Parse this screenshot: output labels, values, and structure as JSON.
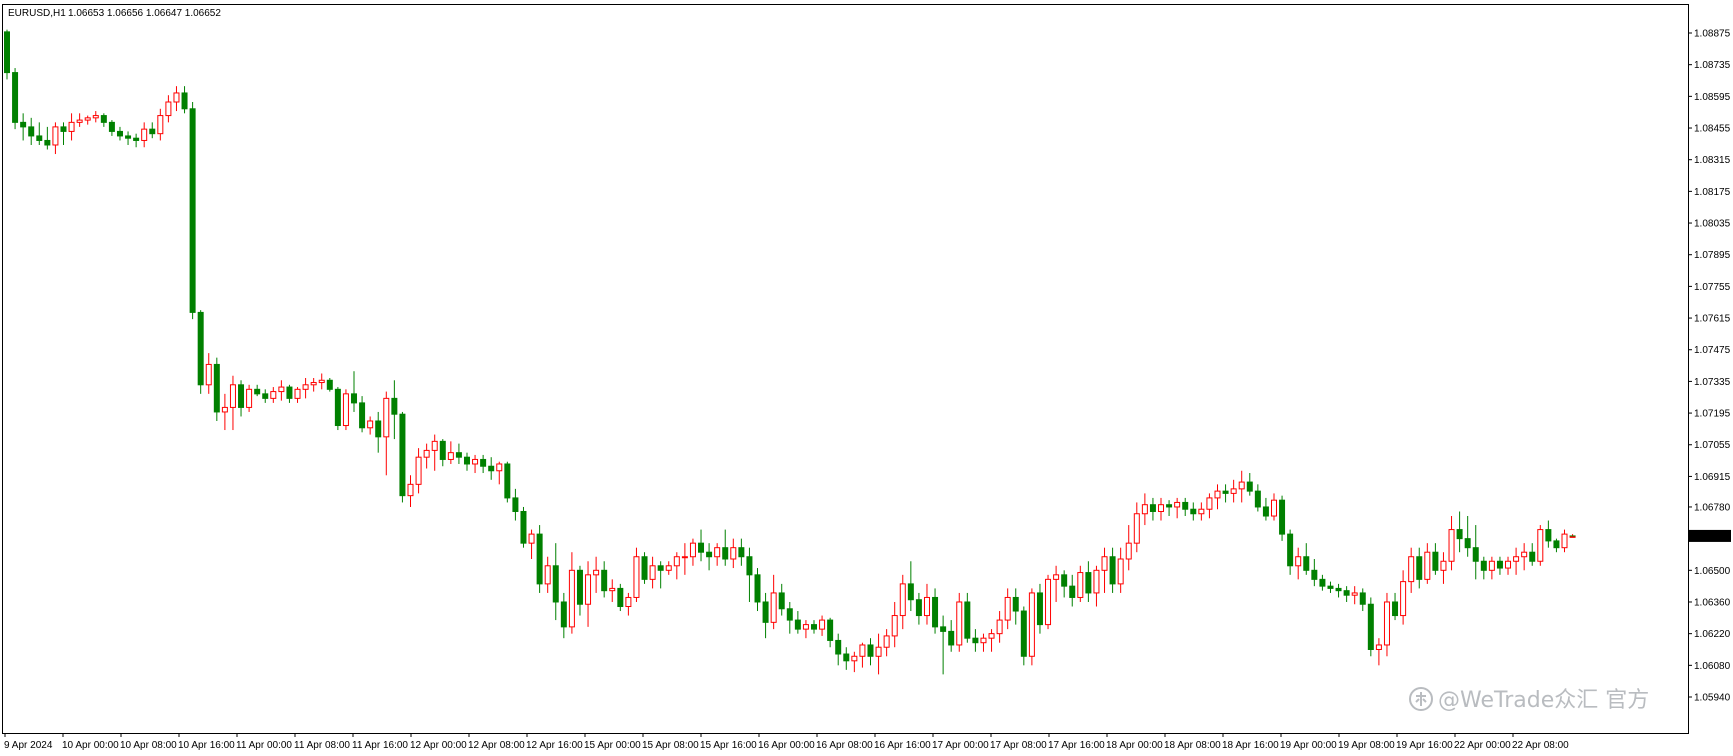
{
  "header": {
    "symbol": "EURUSD,H1",
    "ohlc": "1.06653 1.06656 1.06647 1.06652"
  },
  "watermark": {
    "text": "@WeTrade众汇 官方",
    "icon": "wechat-zhihu-logo-icon"
  },
  "colors": {
    "background": "#ffffff",
    "bull": "#ff0000",
    "bear": "#008000",
    "axis": "#000000",
    "current_price_bg": "#000000",
    "current_price_text": "#ffffff"
  },
  "chart_data": {
    "type": "candlestick",
    "symbol": "EURUSD",
    "timeframe": "H1",
    "grid": false,
    "ylim": [
      1.0594,
      1.0895
    ],
    "price_ticks": [
      "1.08875",
      "1.08735",
      "1.08595",
      "1.08455",
      "1.08315",
      "1.08175",
      "1.08035",
      "1.07895",
      "1.07755",
      "1.07615",
      "1.07475",
      "1.07335",
      "1.07195",
      "1.07055",
      "1.06915",
      "1.06780",
      "1.06652",
      "1.06500",
      "1.06360",
      "1.06220",
      "1.06080",
      "1.05940"
    ],
    "current_price": "1.06652",
    "time_labels": [
      "9 Apr 2024",
      "10 Apr 00:00",
      "10 Apr 08:00",
      "10 Apr 16:00",
      "11 Apr 00:00",
      "11 Apr 08:00",
      "11 Apr 16:00",
      "12 Apr 00:00",
      "12 Apr 08:00",
      "12 Apr 16:00",
      "15 Apr 00:00",
      "15 Apr 08:00",
      "15 Apr 16:00",
      "16 Apr 00:00",
      "16 Apr 08:00",
      "16 Apr 16:00",
      "17 Apr 00:00",
      "17 Apr 08:00",
      "17 Apr 16:00",
      "18 Apr 00:00",
      "18 Apr 08:00",
      "18 Apr 16:00",
      "19 Apr 00:00",
      "19 Apr 08:00",
      "19 Apr 16:00",
      "22 Apr 00:00",
      "22 Apr 08:00"
    ],
    "candles": [
      [
        1.0888,
        1.0889,
        1.0867,
        1.087
      ],
      [
        1.087,
        1.0872,
        1.0845,
        1.0848
      ],
      [
        1.0848,
        1.0852,
        1.084,
        1.0846
      ],
      [
        1.0846,
        1.085,
        1.0838,
        1.0842
      ],
      [
        1.0842,
        1.0848,
        1.0838,
        1.084
      ],
      [
        1.084,
        1.0846,
        1.0836,
        1.0838
      ],
      [
        1.0838,
        1.0848,
        1.0834,
        1.0846
      ],
      [
        1.0846,
        1.0848,
        1.0838,
        1.0844
      ],
      [
        1.0844,
        1.0852,
        1.084,
        1.0848
      ],
      [
        1.0848,
        1.0852,
        1.0846,
        1.0849
      ],
      [
        1.0849,
        1.0851,
        1.0847,
        1.085
      ],
      [
        1.085,
        1.0853,
        1.0848,
        1.0851
      ],
      [
        1.0851,
        1.0852,
        1.0846,
        1.0848
      ],
      [
        1.0848,
        1.0849,
        1.0842,
        1.0844
      ],
      [
        1.0844,
        1.0846,
        1.084,
        1.0842
      ],
      [
        1.0842,
        1.0844,
        1.0838,
        1.0841
      ],
      [
        1.0841,
        1.0843,
        1.0837,
        1.084
      ],
      [
        1.084,
        1.0848,
        1.0837,
        1.0845
      ],
      [
        1.0845,
        1.0848,
        1.0841,
        1.0843
      ],
      [
        1.0843,
        1.0854,
        1.084,
        1.0851
      ],
      [
        1.0851,
        1.086,
        1.0848,
        1.0857
      ],
      [
        1.0857,
        1.0864,
        1.0853,
        1.0861
      ],
      [
        1.0861,
        1.0864,
        1.0852,
        1.0854
      ],
      [
        1.0854,
        1.0857,
        1.0761,
        1.0764
      ],
      [
        1.0764,
        1.0765,
        1.0728,
        1.0732
      ],
      [
        1.0732,
        1.0746,
        1.0728,
        1.0741
      ],
      [
        1.0741,
        1.0744,
        1.0716,
        1.072
      ],
      [
        1.072,
        1.0728,
        1.0712,
        1.0722
      ],
      [
        1.0722,
        1.0736,
        1.0712,
        1.0732
      ],
      [
        1.0732,
        1.0734,
        1.0718,
        1.0722
      ],
      [
        1.0722,
        1.0732,
        1.072,
        1.073
      ],
      [
        1.073,
        1.0732,
        1.0727,
        1.0728
      ],
      [
        1.0728,
        1.073,
        1.0724,
        1.0726
      ],
      [
        1.0726,
        1.0731,
        1.0724,
        1.0729
      ],
      [
        1.0729,
        1.0734,
        1.0725,
        1.0731
      ],
      [
        1.0731,
        1.0732,
        1.0724,
        1.0726
      ],
      [
        1.0726,
        1.0731,
        1.0724,
        1.073
      ],
      [
        1.073,
        1.0735,
        1.0726,
        1.0732
      ],
      [
        1.0732,
        1.0735,
        1.0729,
        1.0733
      ],
      [
        1.0733,
        1.0737,
        1.073,
        1.0734
      ],
      [
        1.0734,
        1.0735,
        1.0729,
        1.073
      ],
      [
        1.073,
        1.0731,
        1.0712,
        1.0714
      ],
      [
        1.0714,
        1.073,
        1.0712,
        1.0728
      ],
      [
        1.0728,
        1.0738,
        1.072,
        1.0724
      ],
      [
        1.0724,
        1.0727,
        1.0711,
        1.0713
      ],
      [
        1.0713,
        1.0718,
        1.071,
        1.0716
      ],
      [
        1.0716,
        1.072,
        1.0702,
        1.0709
      ],
      [
        1.0709,
        1.0729,
        1.0692,
        1.0726
      ],
      [
        1.0726,
        1.0734,
        1.0708,
        1.0719
      ],
      [
        1.0719,
        1.072,
        1.068,
        1.0683
      ],
      [
        1.0683,
        1.0692,
        1.0678,
        1.0688
      ],
      [
        1.0688,
        1.0704,
        1.0684,
        1.07
      ],
      [
        1.07,
        1.0706,
        1.0695,
        1.0703
      ],
      [
        1.0703,
        1.071,
        1.0694,
        1.0707
      ],
      [
        1.0707,
        1.0708,
        1.0696,
        1.0699
      ],
      [
        1.0699,
        1.0707,
        1.0697,
        1.0702
      ],
      [
        1.0702,
        1.0706,
        1.0697,
        1.07
      ],
      [
        1.07,
        1.0702,
        1.0694,
        1.0697
      ],
      [
        1.0697,
        1.0701,
        1.0693,
        1.0699
      ],
      [
        1.0699,
        1.0701,
        1.0693,
        1.0696
      ],
      [
        1.0696,
        1.07,
        1.069,
        1.0694
      ],
      [
        1.0694,
        1.0698,
        1.0688,
        1.0697
      ],
      [
        1.0697,
        1.0698,
        1.068,
        1.0682
      ],
      [
        1.0682,
        1.0686,
        1.0672,
        1.0676
      ],
      [
        1.0676,
        1.0678,
        1.066,
        1.0662
      ],
      [
        1.0662,
        1.0668,
        1.0655,
        1.0666
      ],
      [
        1.0666,
        1.067,
        1.064,
        1.0644
      ],
      [
        1.0644,
        1.0656,
        1.064,
        1.0652
      ],
      [
        1.0652,
        1.0662,
        1.0628,
        1.0636
      ],
      [
        1.0636,
        1.064,
        1.062,
        1.0625
      ],
      [
        1.0625,
        1.0658,
        1.0622,
        1.065
      ],
      [
        1.065,
        1.0652,
        1.063,
        1.0635
      ],
      [
        1.0635,
        1.0654,
        1.0625,
        1.0648
      ],
      [
        1.0648,
        1.0656,
        1.064,
        1.065
      ],
      [
        1.065,
        1.0654,
        1.0638,
        1.0641
      ],
      [
        1.0641,
        1.0646,
        1.0636,
        1.0642
      ],
      [
        1.0642,
        1.0644,
        1.0632,
        1.0634
      ],
      [
        1.0634,
        1.064,
        1.063,
        1.0638
      ],
      [
        1.0638,
        1.066,
        1.0636,
        1.0656
      ],
      [
        1.0656,
        1.0658,
        1.0644,
        1.0646
      ],
      [
        1.0646,
        1.0656,
        1.0642,
        1.0652
      ],
      [
        1.0652,
        1.0654,
        1.0642,
        1.065
      ],
      [
        1.065,
        1.0654,
        1.0648,
        1.0652
      ],
      [
        1.0652,
        1.0658,
        1.0646,
        1.0656
      ],
      [
        1.0656,
        1.0662,
        1.0648,
        1.0656
      ],
      [
        1.0656,
        1.0664,
        1.0652,
        1.0662
      ],
      [
        1.0662,
        1.0668,
        1.0654,
        1.0658
      ],
      [
        1.0658,
        1.0662,
        1.065,
        1.0656
      ],
      [
        1.0656,
        1.0662,
        1.0652,
        1.066
      ],
      [
        1.066,
        1.0668,
        1.0652,
        1.0655
      ],
      [
        1.0655,
        1.0664,
        1.0651,
        1.066
      ],
      [
        1.066,
        1.0664,
        1.0652,
        1.0656
      ],
      [
        1.0656,
        1.066,
        1.0636,
        1.0648
      ],
      [
        1.0648,
        1.0651,
        1.0632,
        1.0636
      ],
      [
        1.0636,
        1.064,
        1.062,
        1.0627
      ],
      [
        1.0627,
        1.0648,
        1.0624,
        1.064
      ],
      [
        1.064,
        1.0644,
        1.063,
        1.0633
      ],
      [
        1.0633,
        1.0636,
        1.0622,
        1.0628
      ],
      [
        1.0628,
        1.0632,
        1.0622,
        1.0624
      ],
      [
        1.0624,
        1.0628,
        1.062,
        1.0626
      ],
      [
        1.0626,
        1.0628,
        1.0622,
        1.0624
      ],
      [
        1.0624,
        1.063,
        1.0621,
        1.0628
      ],
      [
        1.0628,
        1.0629,
        1.0616,
        1.0619
      ],
      [
        1.0619,
        1.0622,
        1.0608,
        1.0613
      ],
      [
        1.0613,
        1.0616,
        1.0606,
        1.061
      ],
      [
        1.061,
        1.0614,
        1.0605,
        1.0612
      ],
      [
        1.0612,
        1.0618,
        1.0607,
        1.0617
      ],
      [
        1.0617,
        1.062,
        1.0608,
        1.0612
      ],
      [
        1.0612,
        1.0622,
        1.0604,
        1.0616
      ],
      [
        1.0616,
        1.0624,
        1.0612,
        1.0621
      ],
      [
        1.0621,
        1.0636,
        1.0616,
        1.063
      ],
      [
        1.063,
        1.0648,
        1.0624,
        1.0644
      ],
      [
        1.0644,
        1.0654,
        1.0632,
        1.0637
      ],
      [
        1.0637,
        1.064,
        1.0626,
        1.063
      ],
      [
        1.063,
        1.0644,
        1.0626,
        1.0638
      ],
      [
        1.0638,
        1.0642,
        1.0622,
        1.0625
      ],
      [
        1.0625,
        1.063,
        1.0604,
        1.0623
      ],
      [
        1.0623,
        1.0628,
        1.0614,
        1.0617
      ],
      [
        1.0617,
        1.064,
        1.0614,
        1.0636
      ],
      [
        1.0636,
        1.064,
        1.0618,
        1.062
      ],
      [
        1.062,
        1.0624,
        1.0614,
        1.0618
      ],
      [
        1.0618,
        1.0622,
        1.0614,
        1.062
      ],
      [
        1.062,
        1.0624,
        1.0614,
        1.0622
      ],
      [
        1.0622,
        1.0632,
        1.0618,
        1.0628
      ],
      [
        1.0628,
        1.0642,
        1.0624,
        1.0638
      ],
      [
        1.0638,
        1.0642,
        1.0626,
        1.0632
      ],
      [
        1.0632,
        1.0634,
        1.0608,
        1.0612
      ],
      [
        1.0612,
        1.0642,
        1.0608,
        1.064
      ],
      [
        1.064,
        1.0644,
        1.0622,
        1.0626
      ],
      [
        1.0626,
        1.0648,
        1.0624,
        1.0646
      ],
      [
        1.0646,
        1.0652,
        1.0636,
        1.0648
      ],
      [
        1.0648,
        1.065,
        1.0638,
        1.0643
      ],
      [
        1.0643,
        1.0648,
        1.0634,
        1.0638
      ],
      [
        1.0638,
        1.0652,
        1.0636,
        1.0649
      ],
      [
        1.0649,
        1.0654,
        1.0636,
        1.064
      ],
      [
        1.064,
        1.0652,
        1.0634,
        1.065
      ],
      [
        1.065,
        1.066,
        1.064,
        1.0656
      ],
      [
        1.0656,
        1.066,
        1.064,
        1.0644
      ],
      [
        1.0644,
        1.066,
        1.064,
        1.0655
      ],
      [
        1.0655,
        1.067,
        1.065,
        1.0662
      ],
      [
        1.0662,
        1.068,
        1.0658,
        1.0675
      ],
      [
        1.0675,
        1.0684,
        1.067,
        1.0679
      ],
      [
        1.0679,
        1.0682,
        1.0672,
        1.0676
      ],
      [
        1.0676,
        1.0682,
        1.0672,
        1.0679
      ],
      [
        1.0679,
        1.0681,
        1.0674,
        1.0678
      ],
      [
        1.0678,
        1.0682,
        1.0673,
        1.068
      ],
      [
        1.068,
        1.0682,
        1.0674,
        1.0677
      ],
      [
        1.0677,
        1.068,
        1.0672,
        1.0675
      ],
      [
        1.0675,
        1.068,
        1.0672,
        1.0677
      ],
      [
        1.0677,
        1.0684,
        1.0673,
        1.0682
      ],
      [
        1.0682,
        1.0688,
        1.0677,
        1.0685
      ],
      [
        1.0685,
        1.0688,
        1.068,
        1.0684
      ],
      [
        1.0684,
        1.069,
        1.068,
        1.0686
      ],
      [
        1.0686,
        1.0694,
        1.068,
        1.0689
      ],
      [
        1.0689,
        1.0693,
        1.0683,
        1.0685
      ],
      [
        1.0685,
        1.0688,
        1.0676,
        1.0678
      ],
      [
        1.0678,
        1.0682,
        1.0672,
        1.0674
      ],
      [
        1.0674,
        1.0684,
        1.0672,
        1.0681
      ],
      [
        1.0681,
        1.0683,
        1.0663,
        1.0666
      ],
      [
        1.0666,
        1.0668,
        1.0648,
        1.0652
      ],
      [
        1.0652,
        1.066,
        1.0646,
        1.0656
      ],
      [
        1.0656,
        1.0662,
        1.0648,
        1.065
      ],
      [
        1.065,
        1.0655,
        1.0643,
        1.0646
      ],
      [
        1.0646,
        1.0648,
        1.0641,
        1.0643
      ],
      [
        1.0643,
        1.0645,
        1.064,
        1.0642
      ],
      [
        1.0642,
        1.0644,
        1.0638,
        1.0641
      ],
      [
        1.0641,
        1.0643,
        1.0636,
        1.0639
      ],
      [
        1.0639,
        1.0643,
        1.0635,
        1.064
      ],
      [
        1.064,
        1.0642,
        1.0632,
        1.0635
      ],
      [
        1.0635,
        1.0638,
        1.0612,
        1.0615
      ],
      [
        1.0615,
        1.062,
        1.0608,
        1.0617
      ],
      [
        1.0617,
        1.064,
        1.0612,
        1.0636
      ],
      [
        1.0636,
        1.064,
        1.0628,
        1.063
      ],
      [
        1.063,
        1.065,
        1.0626,
        1.0645
      ],
      [
        1.0645,
        1.066,
        1.064,
        1.0656
      ],
      [
        1.0656,
        1.066,
        1.0642,
        1.0646
      ],
      [
        1.0646,
        1.0662,
        1.0644,
        1.0658
      ],
      [
        1.0658,
        1.0662,
        1.0648,
        1.065
      ],
      [
        1.065,
        1.0658,
        1.0644,
        1.0654
      ],
      [
        1.0654,
        1.0674,
        1.065,
        1.0668
      ],
      [
        1.0668,
        1.0676,
        1.0658,
        1.0664
      ],
      [
        1.0664,
        1.0674,
        1.0656,
        1.066
      ],
      [
        1.066,
        1.067,
        1.0646,
        1.0654
      ],
      [
        1.0654,
        1.0656,
        1.0646,
        1.065
      ],
      [
        1.065,
        1.0656,
        1.0646,
        1.0654
      ],
      [
        1.0654,
        1.0656,
        1.0648,
        1.0651
      ],
      [
        1.0651,
        1.0656,
        1.0648,
        1.0654
      ],
      [
        1.0654,
        1.066,
        1.0648,
        1.0656
      ],
      [
        1.0656,
        1.0662,
        1.065,
        1.0658
      ],
      [
        1.0658,
        1.0662,
        1.0652,
        1.0654
      ],
      [
        1.0654,
        1.067,
        1.0652,
        1.0668
      ],
      [
        1.0668,
        1.0672,
        1.066,
        1.0663
      ],
      [
        1.0663,
        1.0664,
        1.0658,
        1.066
      ],
      [
        1.066,
        1.0668,
        1.0658,
        1.0666
      ],
      [
        1.0665,
        1.0666,
        1.0665,
        1.0665
      ]
    ]
  }
}
